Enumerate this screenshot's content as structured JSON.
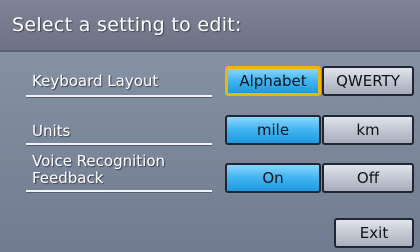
{
  "title": "Select a setting to edit:",
  "settings": [
    {
      "label": "Keyboard Layout",
      "options": [
        "Alphabet",
        "QWERTY"
      ],
      "selected": "Alphabet",
      "focused": "Alphabet"
    },
    {
      "label": "Units",
      "options": [
        "mile",
        "km"
      ],
      "selected": "mile"
    },
    {
      "label_line1": "Voice Recognition",
      "label_line2": "Feedback",
      "options": [
        "On",
        "Off"
      ],
      "selected": "On"
    }
  ],
  "exit_label": "Exit",
  "colors": {
    "selected": "#3fb4f1",
    "focus_border": "#f2b400",
    "unselected": "#c0c6d0",
    "background": "#7f8a9d",
    "title_bar": "#747a8c"
  }
}
